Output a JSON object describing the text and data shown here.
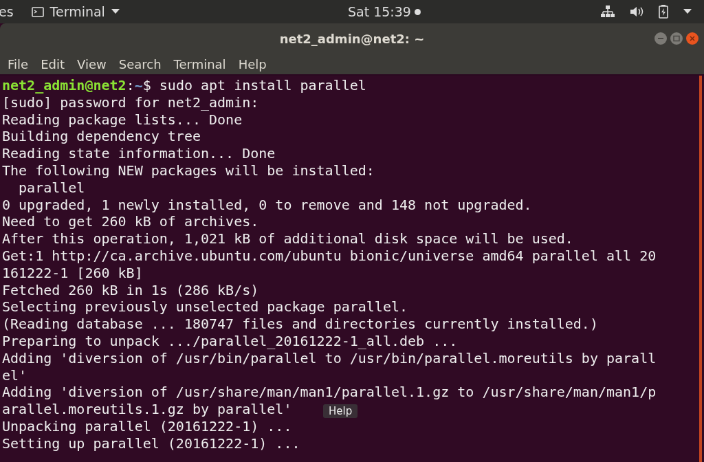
{
  "top_bar": {
    "activities": "es",
    "app_menu": "Terminal",
    "clock": "Sat 15:39",
    "notification_dot": true
  },
  "window": {
    "title": "net2_admin@net2: ~"
  },
  "menu": [
    "File",
    "Edit",
    "View",
    "Search",
    "Terminal",
    "Help"
  ],
  "terminal": {
    "lines": [
      {
        "kind": "prompt",
        "user_host": "net2_admin@net2",
        "sep": ":",
        "path": "~",
        "command": "$ sudo apt install parallel"
      },
      {
        "kind": "output",
        "text": "[sudo] password for net2_admin:"
      },
      {
        "kind": "output",
        "text": "Reading package lists... Done"
      },
      {
        "kind": "output",
        "text": "Building dependency tree"
      },
      {
        "kind": "output",
        "text": "Reading state information... Done"
      },
      {
        "kind": "output",
        "text": "The following NEW packages will be installed:"
      },
      {
        "kind": "output",
        "text": "  parallel"
      },
      {
        "kind": "output",
        "text": "0 upgraded, 1 newly installed, 0 to remove and 148 not upgraded."
      },
      {
        "kind": "output",
        "text": "Need to get 260 kB of archives."
      },
      {
        "kind": "output",
        "text": "After this operation, 1,021 kB of additional disk space will be used."
      },
      {
        "kind": "output",
        "text": "Get:1 http://ca.archive.ubuntu.com/ubuntu bionic/universe amd64 parallel all 20"
      },
      {
        "kind": "output",
        "text": "161222-1 [260 kB]"
      },
      {
        "kind": "output",
        "text": "Fetched 260 kB in 1s (286 kB/s)"
      },
      {
        "kind": "output",
        "text": "Selecting previously unselected package parallel."
      },
      {
        "kind": "output",
        "text": "(Reading database ... 180747 files and directories currently installed.)"
      },
      {
        "kind": "output",
        "text": "Preparing to unpack .../parallel_20161222-1_all.deb ..."
      },
      {
        "kind": "output",
        "text": "Adding 'diversion of /usr/bin/parallel to /usr/bin/parallel.moreutils by parall"
      },
      {
        "kind": "output",
        "text": "el'"
      },
      {
        "kind": "output",
        "text": "Adding 'diversion of /usr/share/man/man1/parallel.1.gz to /usr/share/man/man1/p"
      },
      {
        "kind": "output",
        "text": "arallel.moreutils.1.gz by parallel'"
      },
      {
        "kind": "output",
        "text": "Unpacking parallel (20161222-1) ..."
      },
      {
        "kind": "output",
        "text": "Setting up parallel (20161222-1) ..."
      }
    ]
  },
  "tooltip": {
    "text": "Help"
  }
}
